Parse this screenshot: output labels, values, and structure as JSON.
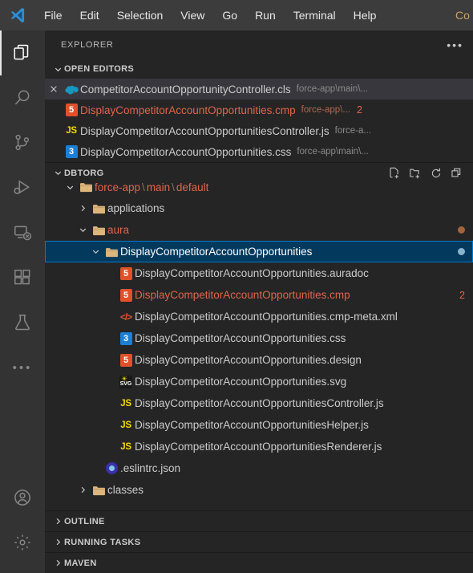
{
  "titlebar": {
    "logo_icon": "vscode-logo-icon",
    "menus": [
      "File",
      "Edit",
      "Selection",
      "View",
      "Go",
      "Run",
      "Terminal",
      "Help"
    ],
    "tab_peek": "Co"
  },
  "activitybar": {
    "items": [
      {
        "name": "explorer",
        "icon": "files-icon",
        "active": true
      },
      {
        "name": "search",
        "icon": "search-icon",
        "active": false
      },
      {
        "name": "source-control",
        "icon": "source-control-icon",
        "active": false
      },
      {
        "name": "run-debug",
        "icon": "run-and-debug-icon",
        "active": false
      },
      {
        "name": "remote-explorer",
        "icon": "remote-explorer-icon",
        "active": false
      },
      {
        "name": "extensions",
        "icon": "extensions-icon",
        "active": false
      },
      {
        "name": "testing",
        "icon": "beaker-icon",
        "active": false
      },
      {
        "name": "more-views",
        "icon": "ellipsis-icon",
        "active": false
      }
    ],
    "bottom_items": [
      {
        "name": "accounts",
        "icon": "account-icon"
      },
      {
        "name": "manage-settings",
        "icon": "gear-icon"
      }
    ]
  },
  "sidebar": {
    "title": "EXPLORER",
    "more_actions_icon": "ellipsis-icon"
  },
  "open_editors": {
    "header": "OPEN EDITORS",
    "expanded": true,
    "items": [
      {
        "label": "CompetitorAccountOpportunityController.cls",
        "description": "force-app\\main\\...",
        "icon": "apex-cloud-icon",
        "active": true,
        "modified": false,
        "show_close": true,
        "badge": ""
      },
      {
        "label": "DisplayCompetitorAccountOpportunities.cmp",
        "description": "force-app\\...",
        "icon": "html-icon",
        "active": false,
        "modified": true,
        "show_close": false,
        "badge": "2"
      },
      {
        "label": "DisplayCompetitorAccountOpportunitiesController.js",
        "description": "force-a...",
        "icon": "js-icon",
        "active": false,
        "modified": false,
        "show_close": false,
        "badge": ""
      },
      {
        "label": "DisplayCompetitorAccountOpportunities.css",
        "description": "force-app\\main\\...",
        "icon": "css-icon",
        "active": false,
        "modified": false,
        "show_close": false,
        "badge": ""
      }
    ]
  },
  "workspace": {
    "header": "DBTORG",
    "expanded": true,
    "actions": [
      {
        "name": "new-file",
        "icon": "new-file-icon"
      },
      {
        "name": "new-folder",
        "icon": "new-folder-icon"
      },
      {
        "name": "refresh",
        "icon": "refresh-icon"
      },
      {
        "name": "collapse-all",
        "icon": "collapse-all-icon"
      }
    ],
    "tree": [
      {
        "label": "force-app \\ main \\ default",
        "parts": [
          "force-app",
          "\\",
          "main",
          "\\",
          "default"
        ],
        "type": "folder",
        "expanded": true,
        "indent": 1,
        "color": "orange",
        "clipped": true,
        "deco_dot": "",
        "badge": ""
      },
      {
        "label": "applications",
        "type": "folder",
        "expanded": false,
        "indent": 2,
        "color": "default",
        "deco_dot": "",
        "badge": ""
      },
      {
        "label": "aura",
        "type": "folder",
        "expanded": true,
        "indent": 2,
        "color": "orange",
        "deco_dot": "#a4643c",
        "badge": ""
      },
      {
        "label": "DisplayCompetitorAccountOpportunities",
        "type": "folder",
        "expanded": true,
        "indent": 3,
        "color": "selected",
        "selected": true,
        "deco_dot": "#8ab3cc",
        "badge": ""
      },
      {
        "label": "DisplayCompetitorAccountOpportunities.auradoc",
        "type": "file",
        "icon": "html-icon",
        "indent": 4,
        "color": "default",
        "deco_dot": "",
        "badge": ""
      },
      {
        "label": "DisplayCompetitorAccountOpportunities.cmp",
        "type": "file",
        "icon": "html-icon",
        "indent": 4,
        "color": "orange",
        "deco_dot": "",
        "badge": "2"
      },
      {
        "label": "DisplayCompetitorAccountOpportunities.cmp-meta.xml",
        "type": "file",
        "icon": "xml-icon",
        "indent": 4,
        "color": "default",
        "deco_dot": "",
        "badge": ""
      },
      {
        "label": "DisplayCompetitorAccountOpportunities.css",
        "type": "file",
        "icon": "css-icon",
        "indent": 4,
        "color": "default",
        "deco_dot": "",
        "badge": ""
      },
      {
        "label": "DisplayCompetitorAccountOpportunities.design",
        "type": "file",
        "icon": "html-icon",
        "indent": 4,
        "color": "default",
        "deco_dot": "",
        "badge": ""
      },
      {
        "label": "DisplayCompetitorAccountOpportunities.svg",
        "type": "file",
        "icon": "svg-icon",
        "indent": 4,
        "color": "default",
        "deco_dot": "",
        "badge": ""
      },
      {
        "label": "DisplayCompetitorAccountOpportunitiesController.js",
        "type": "file",
        "icon": "js-icon",
        "indent": 4,
        "color": "default",
        "deco_dot": "",
        "badge": ""
      },
      {
        "label": "DisplayCompetitorAccountOpportunitiesHelper.js",
        "type": "file",
        "icon": "js-icon",
        "indent": 4,
        "color": "default",
        "deco_dot": "",
        "badge": ""
      },
      {
        "label": "DisplayCompetitorAccountOpportunitiesRenderer.js",
        "type": "file",
        "icon": "js-icon",
        "indent": 4,
        "color": "default",
        "deco_dot": "",
        "badge": ""
      },
      {
        "label": ".eslintrc.json",
        "type": "file",
        "icon": "json-icon",
        "indent": 3,
        "color": "default",
        "deco_dot": "",
        "badge": ""
      },
      {
        "label": "classes",
        "type": "folder",
        "expanded": false,
        "indent": 2,
        "color": "default",
        "deco_dot": "",
        "badge": ""
      }
    ]
  },
  "bottom_sections": [
    {
      "header": "OUTLINE",
      "expanded": false
    },
    {
      "header": "RUNNING TASKS",
      "expanded": false
    },
    {
      "header": "MAVEN",
      "expanded": false
    }
  ],
  "colors": {
    "accent": "#007acc",
    "selection_bg": "#04395e",
    "modified": "#e2644a",
    "sidebar_bg": "#252526",
    "titlebar_bg": "#3c3c3c",
    "activitybar_bg": "#333333"
  }
}
